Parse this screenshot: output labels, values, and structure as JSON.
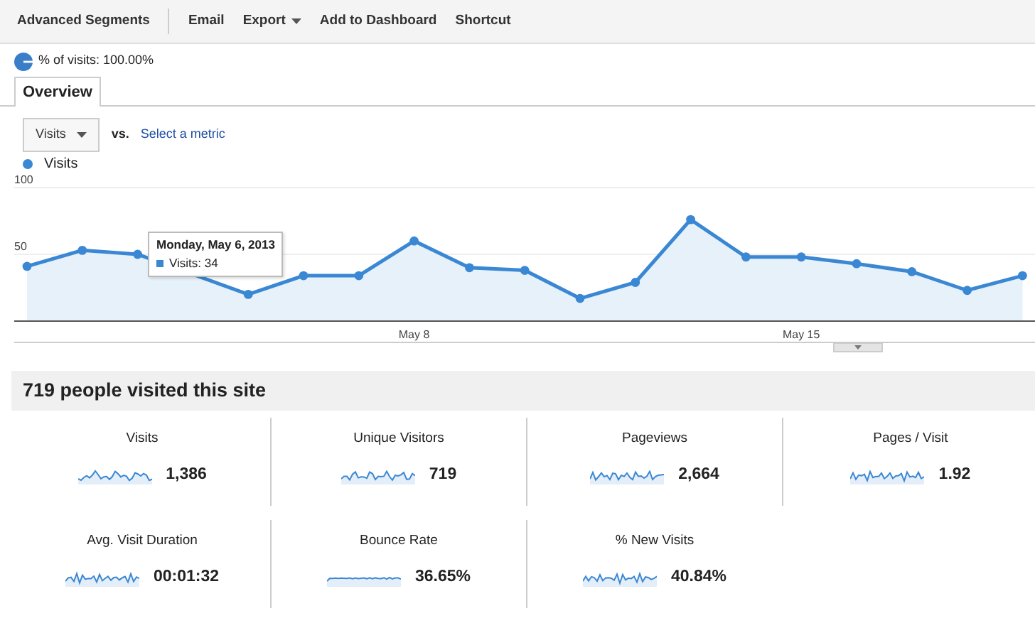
{
  "toolbar": {
    "items": [
      {
        "label": "Advanced Segments",
        "kind": "link"
      },
      {
        "label": "Email",
        "kind": "link"
      },
      {
        "label": "Export",
        "kind": "dropdown"
      },
      {
        "label": "Add to Dashboard",
        "kind": "link"
      },
      {
        "label": "Shortcut",
        "kind": "link"
      }
    ]
  },
  "segment": {
    "label": "% of visits: 100.00%"
  },
  "tabs": [
    {
      "label": "Overview",
      "selected": true
    }
  ],
  "metric_selector": {
    "value": "Visits",
    "vs": "vs.",
    "link": "Select a metric"
  },
  "chart_data": {
    "type": "area",
    "categories": [
      null,
      null,
      null,
      null,
      null,
      null,
      null,
      "May 8",
      null,
      null,
      null,
      null,
      null,
      null,
      "May 15",
      null,
      null,
      null,
      null
    ],
    "series": [
      {
        "name": "Visits",
        "color": "#3a87d3",
        "marker": "circle",
        "values": [
          41,
          53,
          50,
          null,
          20,
          34,
          34,
          60,
          40,
          38,
          17,
          29,
          76,
          48,
          48,
          43,
          37,
          23,
          34
        ]
      }
    ],
    "ylim": [
      0,
      100
    ],
    "yticks": [
      50,
      100
    ]
  },
  "tooltip": {
    "title": "Monday, May 6, 2013",
    "text": "Visits: 34"
  },
  "summary": {
    "title": "719 people visited this site"
  },
  "metrics": [
    {
      "label": "Visits",
      "value": "1,386"
    },
    {
      "label": "Unique Visitors",
      "value": "719"
    },
    {
      "label": "Pageviews",
      "value": "2,664"
    },
    {
      "label": "Pages / Visit",
      "value": "1.92"
    },
    {
      "label": "Avg. Visit Duration",
      "value": "00:01:32"
    },
    {
      "label": "Bounce Rate",
      "value": "36.65%"
    },
    {
      "label": "% New Visits",
      "value": "40.84%"
    }
  ]
}
